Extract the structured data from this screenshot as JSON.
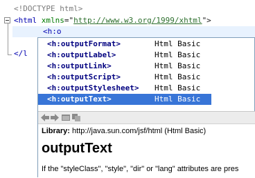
{
  "editor": {
    "line1": "<!DOCTYPE html>",
    "line2": {
      "open": "<html ",
      "attr": "xmlns",
      "eq": "=\"",
      "url": "http://www.w3.org/1999/xhtml",
      "close": "\">"
    },
    "line3": "<h:o",
    "line4": "</l"
  },
  "completion": {
    "items": [
      {
        "tag": "<h:outputFormat>",
        "library": "Html Basic"
      },
      {
        "tag": "<h:outputLabel>",
        "library": "Html Basic"
      },
      {
        "tag": "<h:outputLink>",
        "library": "Html Basic"
      },
      {
        "tag": "<h:outputScript>",
        "library": "Html Basic"
      },
      {
        "tag": "<h:outputStylesheet>",
        "library": "Html Basic"
      },
      {
        "tag": "<h:outputText>",
        "library": "Html Basic"
      }
    ],
    "selected_index": 5
  },
  "doc": {
    "toolbar_icons": [
      "back-arrow-icon",
      "forward-arrow-icon",
      "open-in-browser-icon",
      "copy-icon"
    ],
    "library_label": "Library:",
    "library_value": "http://java.sun.com/jsf/html (Html Basic)",
    "title": "outputText",
    "description": "If the \"styleClass\", \"style\", \"dir\" or \"lang\" attributes are pres"
  },
  "colors": {
    "selection": "#3875d7",
    "current_line": "#e8f2fe",
    "popup_border": "#7f9db9"
  }
}
